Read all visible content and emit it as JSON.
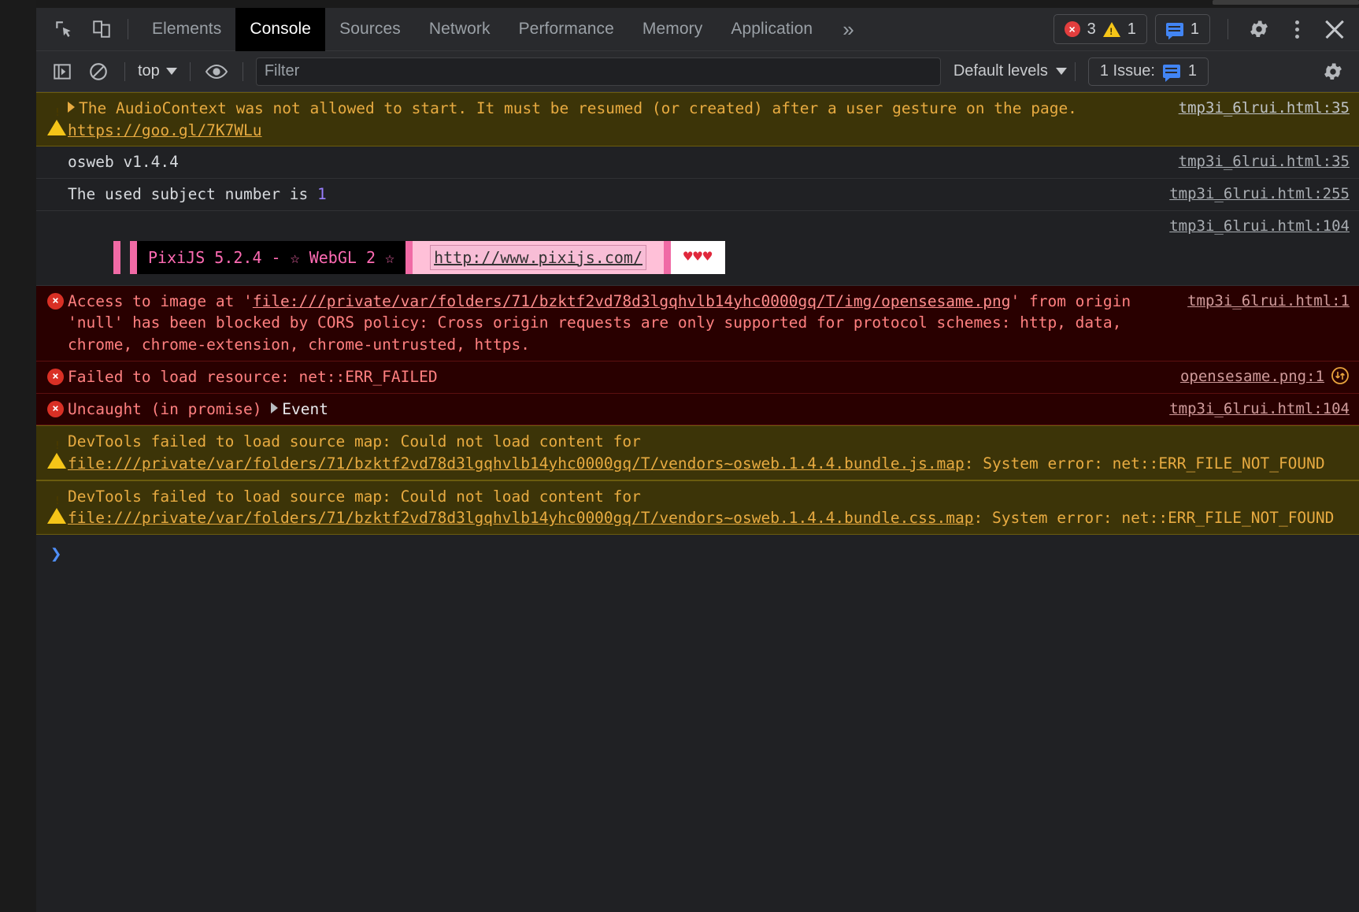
{
  "window": {
    "title": "Chrome DevTools"
  },
  "toolbar": {
    "icons": {
      "inspect": "inspect-element-icon",
      "device": "device-toolbar-icon",
      "settings": "gear-icon",
      "menu": "kebab-menu-icon",
      "close": "close-icon"
    },
    "tabs": [
      {
        "label": "Elements",
        "active": false
      },
      {
        "label": "Console",
        "active": true
      },
      {
        "label": "Sources",
        "active": false
      },
      {
        "label": "Network",
        "active": false
      },
      {
        "label": "Performance",
        "active": false
      },
      {
        "label": "Memory",
        "active": false
      },
      {
        "label": "Application",
        "active": false
      }
    ],
    "more_tabs": "»",
    "counters": {
      "errors": "3",
      "warnings": "1",
      "messages": "1"
    }
  },
  "filterbar": {
    "execute_icon": "execute-script-icon",
    "clear_icon": "clear-console-icon",
    "context_label": "top",
    "eye_icon": "live-expression-icon",
    "filter_placeholder": "Filter",
    "filter_value": "",
    "levels_label": "Default levels",
    "issues_label": "1 Issue:",
    "issues_count": "1",
    "settings_icon": "gear-icon"
  },
  "console": {
    "messages": [
      {
        "type": "warning",
        "expandable": true,
        "text_before_link": "The AudioContext was not allowed to start. It must be resumed (or created) after a user gesture on the page. ",
        "link": "https://goo.gl/7K7WLu",
        "text_after_link": "",
        "source": "tmp3i_6lrui.html:35"
      },
      {
        "type": "info",
        "expandable": false,
        "text_before_link": "osweb v1.4.4",
        "link": "",
        "text_after_link": "",
        "source": "tmp3i_6lrui.html:35"
      },
      {
        "type": "info-number",
        "expandable": false,
        "text_before_link": "The used subject number is ",
        "number": "1",
        "link": "",
        "text_after_link": "",
        "source": "tmp3i_6lrui.html:255"
      },
      {
        "type": "banner",
        "pixi_label": "PixiJS 5.2.4 - ☆ WebGL 2 ☆",
        "pixi_url": "http://www.pixijs.com/",
        "pixi_hearts": "♥♥♥",
        "source": "tmp3i_6lrui.html:104"
      },
      {
        "type": "error",
        "expandable": false,
        "text_before_link": "Access to image at '",
        "link": "file:///private/var/folders/71/bzktf2vd78d3lgqhvlb14yhc0000gq/T/img/opensesame.png",
        "text_after_link": "' from origin 'null' has been blocked by CORS policy: Cross origin requests are only supported for protocol schemes: http, data, chrome, chrome-extension, chrome-untrusted, https.",
        "source": "tmp3i_6lrui.html:1"
      },
      {
        "type": "error",
        "expandable": false,
        "text_before_link": "Failed to load resource: net::ERR_FAILED",
        "link": "",
        "text_after_link": "",
        "source": "opensesame.png:1",
        "has_network_icon": true
      },
      {
        "type": "error-object",
        "expandable": true,
        "text_before_link": "Uncaught (in promise) ",
        "object_name": "Event",
        "link": "",
        "text_after_link": "",
        "source": "tmp3i_6lrui.html:104"
      },
      {
        "type": "warning",
        "expandable": false,
        "text_before_link": "DevTools failed to load source map: Could not load content for ",
        "link": "file:///private/var/folders/71/bzktf2vd78d3lgqhvlb14yhc0000gq/T/vendors~osweb.1.4.4.bundle.js.map",
        "text_after_link": ": System error: net::ERR_FILE_NOT_FOUND",
        "source": ""
      },
      {
        "type": "warning",
        "expandable": false,
        "text_before_link": "DevTools failed to load source map: Could not load content for ",
        "link": "file:///private/var/folders/71/bzktf2vd78d3lgqhvlb14yhc0000gq/T/vendors~osweb.1.4.4.bundle.css.map",
        "text_after_link": ": System error: net::ERR_FILE_NOT_FOUND",
        "source": ""
      }
    ],
    "prompt_caret": "❯",
    "prompt_value": ""
  },
  "colors": {
    "warning_bg": "#3c3408",
    "warning_text": "#e8ab41",
    "error_bg": "#290000",
    "error_text": "#ff8080",
    "panel_bg": "#202124",
    "toolbar_bg": "#292a2d",
    "accent_blue": "#4285f4",
    "error_red": "#d93025",
    "warn_yellow": "#f5c518",
    "pixi_pink": "#f06aa5",
    "number_purple": "#9a7fff"
  }
}
